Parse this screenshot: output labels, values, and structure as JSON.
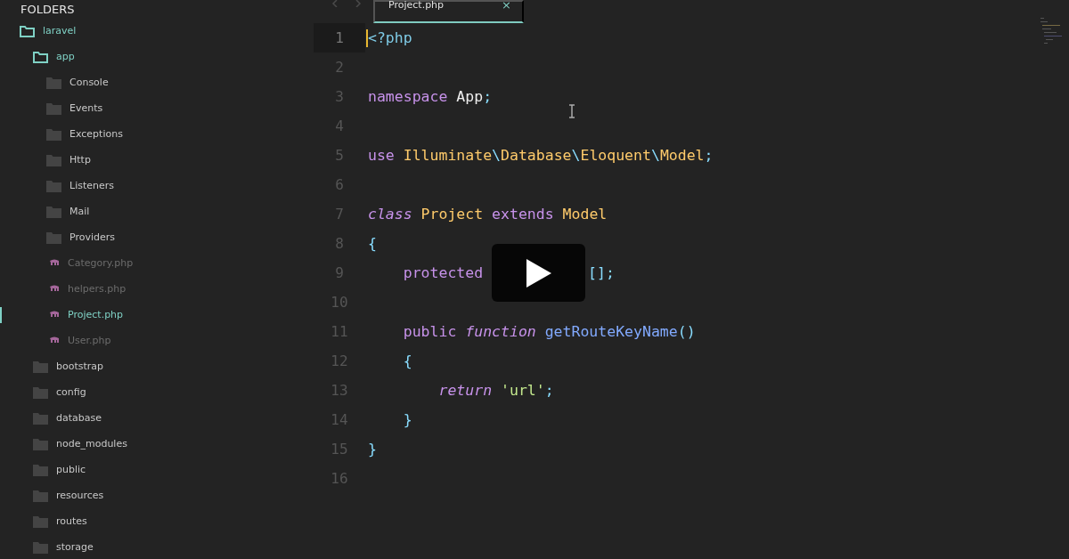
{
  "sidebar": {
    "title": "FOLDERS",
    "tree": [
      {
        "kind": "folder",
        "label": "laravel",
        "expanded": true,
        "children": [
          {
            "kind": "folder",
            "label": "app",
            "expanded": true,
            "children": [
              {
                "kind": "folder",
                "label": "Console",
                "expanded": false
              },
              {
                "kind": "folder",
                "label": "Events",
                "expanded": false
              },
              {
                "kind": "folder",
                "label": "Exceptions",
                "expanded": false
              },
              {
                "kind": "folder",
                "label": "Http",
                "expanded": false
              },
              {
                "kind": "folder",
                "label": "Listeners",
                "expanded": false
              },
              {
                "kind": "folder",
                "label": "Mail",
                "expanded": false
              },
              {
                "kind": "folder",
                "label": "Providers",
                "expanded": false
              },
              {
                "kind": "file",
                "label": "Category.php",
                "selected": false
              },
              {
                "kind": "file",
                "label": "helpers.php",
                "selected": false
              },
              {
                "kind": "file",
                "label": "Project.php",
                "selected": true
              },
              {
                "kind": "file",
                "label": "User.php",
                "selected": false
              }
            ]
          },
          {
            "kind": "folder",
            "label": "bootstrap",
            "expanded": false
          },
          {
            "kind": "folder",
            "label": "config",
            "expanded": false
          },
          {
            "kind": "folder",
            "label": "database",
            "expanded": false
          },
          {
            "kind": "folder",
            "label": "node_modules",
            "expanded": false
          },
          {
            "kind": "folder",
            "label": "public",
            "expanded": false
          },
          {
            "kind": "folder",
            "label": "resources",
            "expanded": false
          },
          {
            "kind": "folder",
            "label": "routes",
            "expanded": false
          },
          {
            "kind": "folder",
            "label": "storage",
            "expanded": false
          }
        ]
      }
    ]
  },
  "tabs": [
    {
      "label": "Project.php",
      "selected": true,
      "close": "×"
    }
  ],
  "editor": {
    "lines": [
      {
        "number": "1",
        "current": true,
        "tokens": [
          {
            "kind": "tag",
            "text": "<?php"
          }
        ]
      },
      {
        "number": "2",
        "current": false
      },
      {
        "number": "3",
        "current": false,
        "tokens": [
          {
            "kind": "keyword",
            "text": "namespace "
          },
          {
            "kind": "plain",
            "text": "App"
          },
          {
            "kind": "punct",
            "text": ";"
          }
        ]
      },
      {
        "number": "4",
        "current": false
      },
      {
        "number": "5",
        "current": false,
        "tokens": [
          {
            "kind": "keyword",
            "text": "use "
          },
          {
            "kind": "class",
            "text": "Illuminate"
          },
          {
            "kind": "punct",
            "text": "\\"
          },
          {
            "kind": "class",
            "text": "Database"
          },
          {
            "kind": "punct",
            "text": "\\"
          },
          {
            "kind": "class",
            "text": "Eloquent"
          },
          {
            "kind": "punct",
            "text": "\\"
          },
          {
            "kind": "class",
            "text": "Model"
          },
          {
            "kind": "punct",
            "text": ";"
          }
        ]
      },
      {
        "number": "6",
        "current": false
      },
      {
        "number": "7",
        "current": false,
        "tokens": [
          {
            "kind": "italic",
            "text": "class "
          },
          {
            "kind": "class",
            "text": "Project "
          },
          {
            "kind": "keyword",
            "text": "extends "
          },
          {
            "kind": "class",
            "text": "Model"
          }
        ]
      },
      {
        "number": "8",
        "current": false,
        "tokens": [
          {
            "kind": "punct",
            "text": "{"
          }
        ]
      },
      {
        "number": "9",
        "current": false,
        "tokens": [
          {
            "kind": "keyword",
            "text": "    protected "
          },
          {
            "kind": "play"
          },
          {
            "kind": "punct",
            "text": "[];"
          }
        ]
      },
      {
        "number": "10",
        "current": false
      },
      {
        "number": "11",
        "current": false,
        "tokens": [
          {
            "kind": "keyword",
            "text": "    public "
          },
          {
            "kind": "italic",
            "text": "function "
          },
          {
            "kind": "func",
            "text": "getRouteKeyName"
          },
          {
            "kind": "punct",
            "text": "()"
          }
        ]
      },
      {
        "number": "12",
        "current": false,
        "tokens": [
          {
            "kind": "punct",
            "text": "    {"
          }
        ]
      },
      {
        "number": "13",
        "current": false,
        "tokens": [
          {
            "kind": "italic",
            "text": "        return "
          },
          {
            "kind": "string",
            "text": "'url'"
          },
          {
            "kind": "punct",
            "text": ";"
          }
        ]
      },
      {
        "number": "14",
        "current": false,
        "tokens": [
          {
            "kind": "punct",
            "text": "    }"
          }
        ]
      },
      {
        "number": "15",
        "current": false,
        "tokens": [
          {
            "kind": "punct",
            "text": "}"
          }
        ]
      },
      {
        "number": "16",
        "current": false
      }
    ]
  }
}
